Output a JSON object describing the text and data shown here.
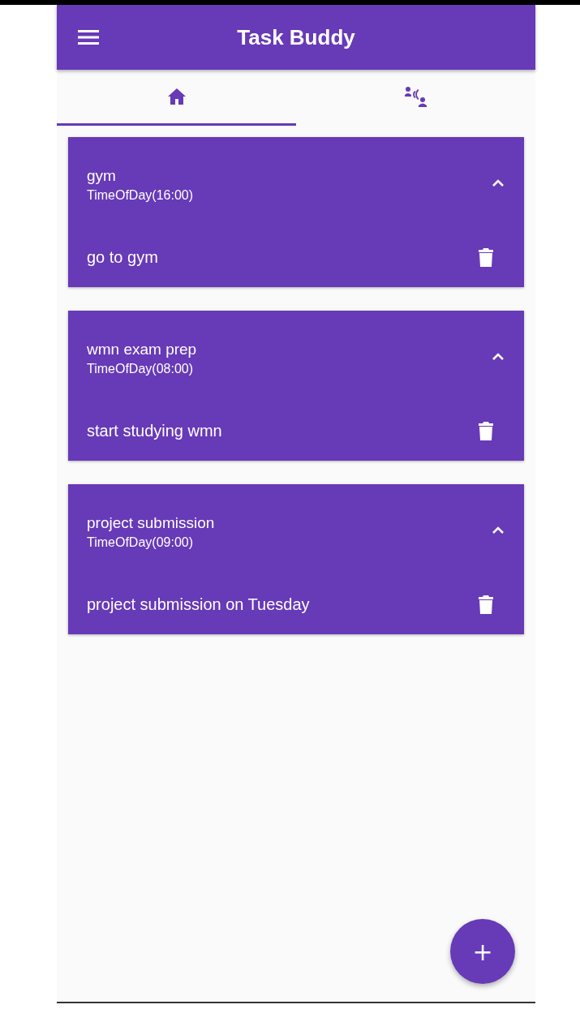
{
  "app_bar": {
    "title": "Task Buddy"
  },
  "tabs": [
    {
      "kind": "home",
      "selected": true
    },
    {
      "kind": "people",
      "selected": false
    }
  ],
  "tasks": [
    {
      "title": "gym",
      "time": "TimeOfDay(16:00)",
      "expanded": true,
      "items": [
        {
          "text": "go to gym"
        }
      ]
    },
    {
      "title": "wmn exam prep",
      "time": "TimeOfDay(08:00)",
      "expanded": true,
      "items": [
        {
          "text": "start studying wmn"
        }
      ]
    },
    {
      "title": "project submission",
      "time": "TimeOfDay(09:00)",
      "expanded": true,
      "items": [
        {
          "text": "project submission on Tuesday"
        }
      ]
    }
  ],
  "fab": {
    "label": "+"
  }
}
